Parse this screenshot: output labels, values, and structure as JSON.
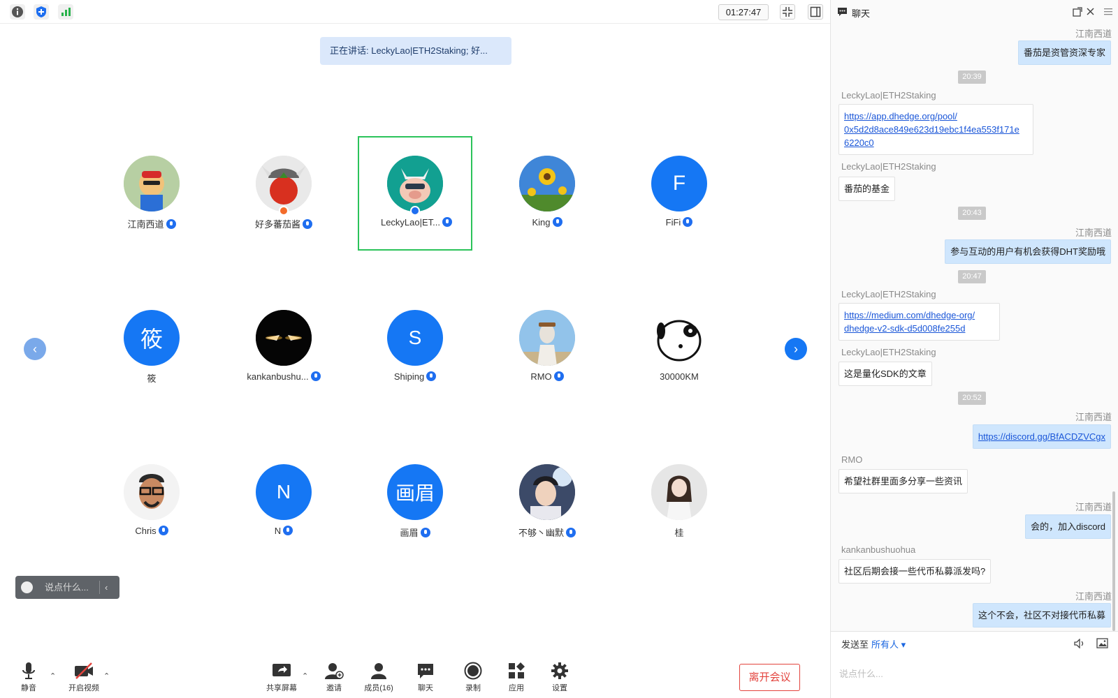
{
  "topbar": {
    "clock": "01:27:47"
  },
  "speaking": "正在讲话: LeckyLao|ETH2Staking; 好...",
  "participants": [
    {
      "name": "江南西道",
      "mic": true
    },
    {
      "name": "好多蕃茄酱",
      "mic": true
    },
    {
      "name": "LeckyLao|ET...",
      "mic": true
    },
    {
      "name": "King",
      "mic": true
    },
    {
      "name": "FiFi",
      "mic": true,
      "initial": "F"
    },
    {
      "name": "筱",
      "mic": false,
      "initial": "筱"
    },
    {
      "name": "kankanbushu...",
      "mic": true
    },
    {
      "name": "Shiping",
      "mic": true,
      "initial": "S"
    },
    {
      "name": "RMO",
      "mic": true
    },
    {
      "name": "30000KM",
      "mic": false
    },
    {
      "name": "Chris",
      "mic": true
    },
    {
      "name": "N",
      "mic": true,
      "initial": "N"
    },
    {
      "name": "画眉",
      "mic": true,
      "initial": "画眉"
    },
    {
      "name": "不够丶幽默",
      "mic": true
    },
    {
      "name": "桂",
      "mic": false
    }
  ],
  "say_box": {
    "placeholder": "说点什么..."
  },
  "toolbar": {
    "mute": "静音",
    "video": "开启视频",
    "share": "共享屏幕",
    "invite": "邀请",
    "members": "成员(16)",
    "chat": "聊天",
    "record": "录制",
    "apps": "应用",
    "settings": "设置",
    "leave": "离开会议"
  },
  "colors": {
    "accent": "#1577f4",
    "active_border": "#2bc35a",
    "leave": "#e3433d"
  },
  "chat": {
    "title": "聊天",
    "messages": [
      {
        "sender": "江南西道",
        "text": "番茄是资管资深专家"
      },
      {
        "time": "20:39"
      },
      {
        "sender": "LeckyLao|ETH2Staking",
        "link_lines": [
          "https://app.dhedge.org/pool/",
          "0x5d2d8ace849e623d19ebc1f4ea553f171e",
          "6220c0"
        ]
      },
      {
        "sender": "LeckyLao|ETH2Staking",
        "text": "番茄的基金"
      },
      {
        "time": "20:43"
      },
      {
        "sender": "江南西道",
        "text": "参与互动的用户有机会获得DHT奖励哦"
      },
      {
        "time": "20:47"
      },
      {
        "sender": "LeckyLao|ETH2Staking",
        "link_lines": [
          "https://medium.com/dhedge-org/",
          "dhedge-v2-sdk-d5d008fe255d"
        ]
      },
      {
        "sender": "LeckyLao|ETH2Staking",
        "text": "这是量化SDK的文章"
      },
      {
        "time": "20:52"
      },
      {
        "sender": "江南西道",
        "link_lines": [
          "https://discord.gg/BfACDZVCgx"
        ]
      },
      {
        "sender": "RMO",
        "text": "希望社群里面多分享一些资讯"
      },
      {
        "sender": "江南西道",
        "text": "会的，加入discord"
      },
      {
        "sender": "kankanbushuohua",
        "text": "社区后期会接一些代币私募派发吗?"
      },
      {
        "sender": "江南西道",
        "text": "这个不会，社区不对接代币私募"
      }
    ],
    "send_to_label": "发送至",
    "send_to_target": "所有人",
    "input_placeholder": "说点什么..."
  }
}
